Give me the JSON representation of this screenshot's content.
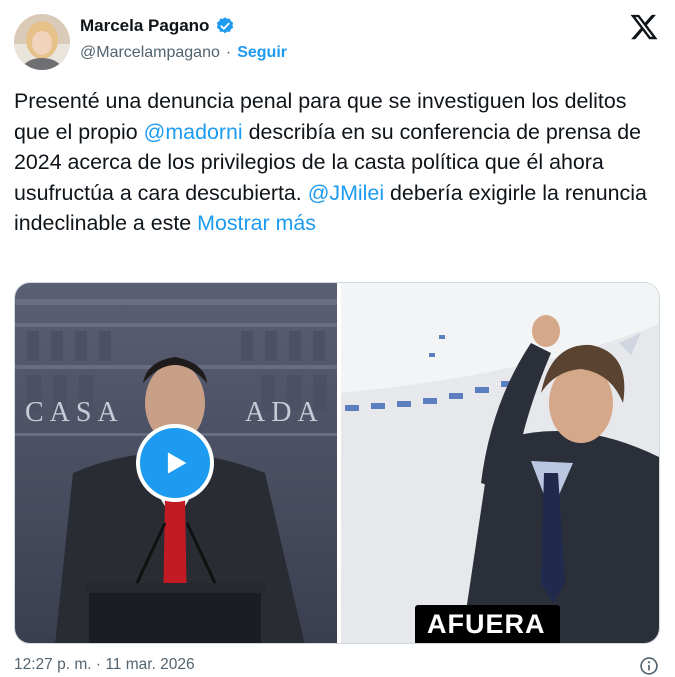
{
  "author": {
    "name": "Marcela Pagano",
    "handle": "@Marcelampagano",
    "separator": "·",
    "follow_label": "Seguir"
  },
  "tweet": {
    "segments": [
      {
        "text": "Presenté una denuncia penal para que se investiguen los delitos que el propio ",
        "type": "text"
      },
      {
        "text": "@madorni",
        "type": "mention"
      },
      {
        "text": " describía en su conferencia de prensa de 2024 acerca de los privilegios de la casta política que él ahora usufructúa a cara descubierta. ",
        "type": "text"
      },
      {
        "text": "@JMilei",
        "type": "mention"
      },
      {
        "text": " debería exigirle la renuncia indeclinable a este ",
        "type": "text"
      },
      {
        "text": "Mostrar más",
        "type": "link"
      }
    ]
  },
  "media": {
    "left_video": {
      "backdrop_text": "CASA ROSADA",
      "play_icon": "play-icon"
    },
    "right_video": {
      "caption": "AFUERA"
    }
  },
  "footer": {
    "timestamp": "12:27 p. m. · 11 mar. 2026"
  },
  "icons": {
    "verified": "verified-badge-icon",
    "x_logo": "x-logo-icon",
    "info": "info-icon"
  },
  "colors": {
    "accent": "#1d9bf0",
    "text": "#0f1419",
    "muted": "#536471"
  }
}
